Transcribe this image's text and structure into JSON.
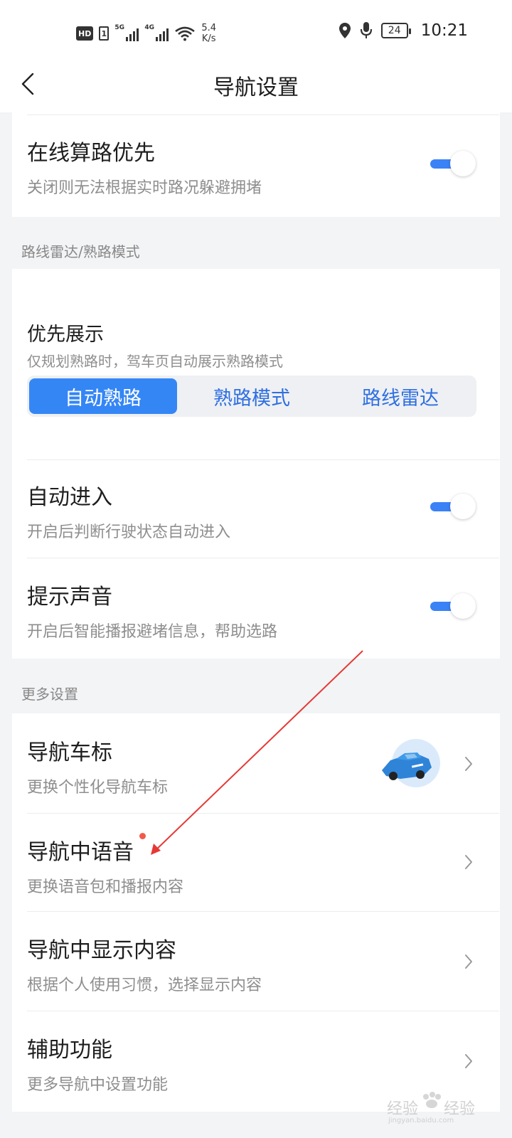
{
  "status_bar": {
    "hd": "HD",
    "sim": "1",
    "net1": "5G",
    "net2": "4G",
    "speed_value": "5.4",
    "speed_unit": "K/s",
    "battery": "24",
    "time": "10:21",
    "icons": [
      "wifi-icon",
      "location-icon",
      "mic-icon",
      "battery-icon"
    ]
  },
  "header": {
    "title": "导航设置",
    "back_icon": "chevron-left-icon"
  },
  "card1": {
    "online_route": {
      "title": "在线算路优先",
      "subtitle": "关闭则无法根据实时路况躲避拥堵",
      "enabled": true
    }
  },
  "section_route_radar": "路线雷达/熟路模式",
  "card2": {
    "priority": {
      "title": "优先展示",
      "subtitle": "仅规划熟路时，驾车页自动展示熟路模式",
      "options": [
        "自动熟路",
        "熟路模式",
        "路线雷达"
      ],
      "selected": "自动熟路"
    },
    "auto_enter": {
      "title": "自动进入",
      "subtitle": "开启后判断行驶状态自动进入",
      "enabled": true
    },
    "sound": {
      "title": "提示声音",
      "subtitle": "开启后智能播报避堵信息，帮助选路",
      "enabled": true
    }
  },
  "section_more": "更多设置",
  "card3": {
    "car_icon": {
      "title": "导航车标",
      "subtitle": "更换个性化导航车标"
    },
    "voice": {
      "title": "导航中语音",
      "subtitle": "更换语音包和播报内容",
      "has_new": true
    },
    "display": {
      "title": "导航中显示内容",
      "subtitle": "根据个人使用习惯，选择显示内容"
    },
    "assist": {
      "title": "辅助功能",
      "subtitle": "更多导航中设置功能"
    }
  },
  "colors": {
    "accent": "#3486f5",
    "toggle_track": "#3b82f6",
    "annotation_arrow": "#e53935",
    "new_dot": "#f05a4a"
  },
  "watermark": {
    "text": "经验",
    "sub": "jingyan.baidu.com"
  }
}
